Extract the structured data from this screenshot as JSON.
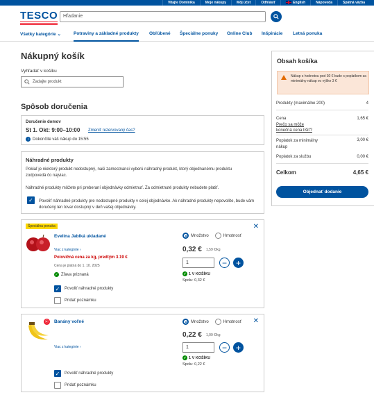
{
  "topbar": [
    "Vitajte Dominika",
    "Moje nákupy",
    "Môj účet",
    "Odhlásiť",
    "English",
    "Nápoveda",
    "Spätná väzba"
  ],
  "logo": "TESCO",
  "search": {
    "placeholder": "Hľadanie"
  },
  "nav": [
    "Všetky kategórie",
    "Potraviny a základné produkty",
    "Obľúbené",
    "Špeciálne ponuky",
    "Online Club",
    "Inšpirácie",
    "Letná ponuka"
  ],
  "page_title": "Nákupný košík",
  "cart_search": {
    "label": "Vyhľadať v košíku",
    "placeholder": "Zadajte produkt"
  },
  "delivery": {
    "heading": "Spôsob doručenia",
    "type": "Doručenie domov",
    "slot": "St 1. Okt: 9:00–10:00",
    "change": "Zmeniť rezervovaný čas?",
    "deadline": "Dokončite váš nákup do 15:55"
  },
  "substitutes": {
    "title": "Náhradné produkty",
    "p1": "Pokiaľ je niektorý produkt nedostupný, naši zamestnanci vyberú náhradný produkt, ktorý objednanému produktu zodpovedá čo najviac.",
    "p2": "Náhradné produkty môžete pri preberaní objednávky odmietnuť. Za odmietnuté produkty nebudete platiť.",
    "allow_all": "Povoliť náhradné produkty pre nedostupné produkty v celej objednávke. Ak náhradné produkty nepovolíte, bude vám doručený len tovar dostupný v deň vašej objednávky."
  },
  "items": [
    {
      "badge": "Špeciálna ponuka",
      "name": "Evelina Jablká ukladané",
      "more": "Viac z kategórie",
      "offer": "Polovičná cena za kg, predtým 3.19 €",
      "valid": "Cena je platná do 1. 10. 2025",
      "health": "Zľava priznaná",
      "opt1": "Množstvo",
      "opt2": "Hmotnosť",
      "price": "0,32 €",
      "unit": "1,59 €/kg",
      "qty": "1",
      "in_cart": "1 V KOŠÍKU",
      "total": "Spolu: 0,32 €",
      "allow": "Povoliť náhradné produkty",
      "note": "Pridať poznámku"
    },
    {
      "name": "Banány voľné",
      "more": "Viac z kategórie",
      "opt1": "Množstvo",
      "opt2": "Hmotnosť",
      "price": "0,22 €",
      "unit": "1,09 €/kg",
      "qty": "1",
      "in_cart": "1 V KOŠÍKU",
      "total": "Spolu: 0,22 €",
      "allow": "Povoliť náhradné produkty",
      "note": "Pridať poznámku"
    }
  ],
  "summary": {
    "title": "Obsah košíka",
    "warning": "Nákup s hodnotou pod 30 € bude s poplatkom za minimálny nákup vo výške 3 €",
    "products_label": "Produkty (maximálne 200)",
    "products_val": "4",
    "price_label": "Cena",
    "price_val": "1,65 €",
    "price_link": "Prečo sa môže konečná cena líšiť?",
    "minfee_label": "Poplatok za minimálny nákup",
    "minfee_val": "3,00 €",
    "service_label": "Poplatok za službu",
    "service_val": "0,00 €",
    "total_label": "Celkom",
    "total_val": "4,65 €",
    "order_btn": "Objednať dodanie"
  },
  "colors": {
    "brand": "#00539f",
    "red": "#ee1c2e",
    "promo": "#fcd700",
    "green": "#008a00"
  }
}
